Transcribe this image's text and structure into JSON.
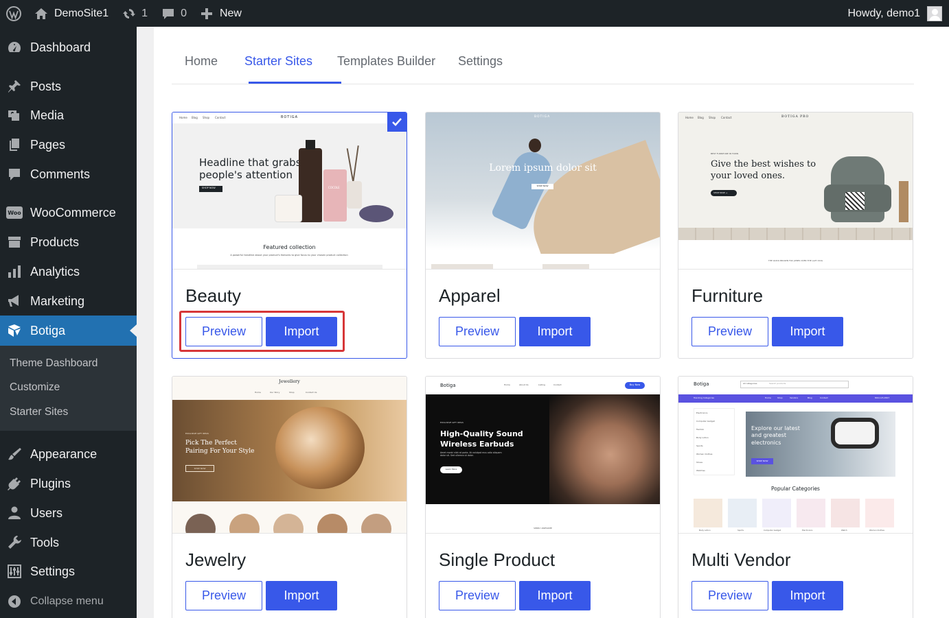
{
  "adminbar": {
    "site_name": "DemoSite1",
    "updates_count": "1",
    "comments_count": "0",
    "new_label": "New",
    "greeting": "Howdy, demo1"
  },
  "sidebar": {
    "items": [
      {
        "label": "Dashboard",
        "icon": "dashboard-icon"
      },
      {
        "label": "Posts",
        "icon": "pin-icon"
      },
      {
        "label": "Media",
        "icon": "media-icon"
      },
      {
        "label": "Pages",
        "icon": "pages-icon"
      },
      {
        "label": "Comments",
        "icon": "comment-icon"
      },
      {
        "label": "WooCommerce",
        "icon": "woo-icon"
      },
      {
        "label": "Products",
        "icon": "archive-icon"
      },
      {
        "label": "Analytics",
        "icon": "bar-chart-icon"
      },
      {
        "label": "Marketing",
        "icon": "megaphone-icon"
      },
      {
        "label": "Botiga",
        "icon": "botiga-icon"
      },
      {
        "label": "Appearance",
        "icon": "paintbrush-icon"
      },
      {
        "label": "Plugins",
        "icon": "plug-icon"
      },
      {
        "label": "Users",
        "icon": "user-icon"
      },
      {
        "label": "Tools",
        "icon": "wrench-icon"
      },
      {
        "label": "Settings",
        "icon": "settings-icon"
      }
    ],
    "submenu": [
      "Theme Dashboard",
      "Customize",
      "Starter Sites"
    ],
    "collapse_label": "Collapse menu"
  },
  "tabs": [
    "Home",
    "Starter Sites",
    "Templates Builder",
    "Settings"
  ],
  "active_tab": "Starter Sites",
  "buttons": {
    "preview": "Preview",
    "import": "Import"
  },
  "cards": [
    {
      "title": "Beauty",
      "selected": true,
      "thumb": {
        "brand": "BOTIGA",
        "nav": [
          "Home",
          "Blog",
          "Shop",
          "Contact"
        ],
        "headline": "Headline that grabs people's attention",
        "cta": "SHOP NOW",
        "section_title": "Featured collection",
        "section_sub": "A powerful headline about your product's features to give focus to your chosen product collection",
        "product_label": "COCOLE"
      }
    },
    {
      "title": "Apparel",
      "thumb": {
        "brand": "BOTIGA",
        "headline": "Lorem ipsum dolor sit",
        "cta": "SHOP NOW"
      }
    },
    {
      "title": "Furniture",
      "thumb": {
        "brand": "BOTIGA PRO",
        "nav": [
          "Home",
          "Blog",
          "Shop",
          "Contact"
        ],
        "kicker": "BEST FURNITURE IN TOWN",
        "headline": "Give the best wishes to your loved ones.",
        "cta": "SHOP NOW →",
        "footer_text": "THE QUICK BROWN FOX JUMPS OVER THE LAZY DOG"
      }
    },
    {
      "title": "Jewelry",
      "thumb": {
        "brand": "Jewellery",
        "nav": [
          "Home",
          "Our Story",
          "Shop",
          "Contact Us"
        ],
        "kicker": "EXCLUSIVE GIFT IDEAS",
        "headline": "Pick The Perfect Pairing For Your Style",
        "cta": "SHOP NOW"
      }
    },
    {
      "title": "Single Product",
      "thumb": {
        "brand": "Botiga",
        "nav": [
          "Home",
          "About Us",
          "Listing",
          "Contact"
        ],
        "buy": "Buy Now",
        "kicker": "EXCLUSIVE GIFT IDEAS",
        "headline": "High-Quality Sound Wireless Earbuds",
        "body": "Amet morbi nibh at porta. At volutpat mus odio aliquam dolor sit. Sed ullamco ut dolor.",
        "cta": "Learn More",
        "footer_text": "SIMPLY AWESOME"
      }
    },
    {
      "title": "Multi Vendor",
      "thumb": {
        "brand": "Botiga",
        "search_cat": "All categories",
        "search_ph": "Search products",
        "bar_left": "Trending Categories",
        "bar_nav": [
          "Home",
          "Shop",
          "Vendors",
          "Blog",
          "Contact"
        ],
        "phone": "800-123-4567",
        "side_cats": [
          "Electronics",
          "Computer Gadget",
          "Fashion",
          "Body Lotion",
          "Sports",
          "Women Clothes",
          "Shoes",
          "Watches"
        ],
        "headline": "Explore our latest and greatest electronics",
        "cta": "SHOP NOW",
        "section_title": "Popular Categories",
        "cat_labels": [
          "Body Lotion",
          "Sports",
          "Computer Gadget",
          "Electronics",
          "Watch",
          "Women Clothes"
        ]
      }
    }
  ],
  "colors": {
    "accent": "#3858e9",
    "sidebar_bg": "#1d2327",
    "active_menu": "#2271b1",
    "highlight": "#d63638"
  }
}
